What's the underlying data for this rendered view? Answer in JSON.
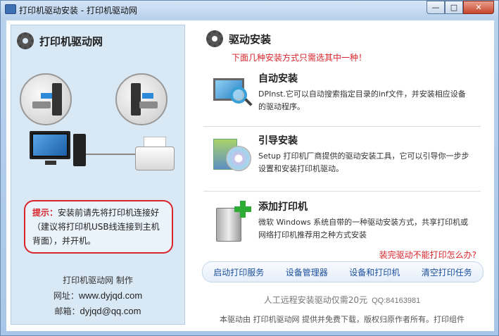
{
  "window": {
    "title": "打印机驱动安装 - 打印机驱动网",
    "controls": {
      "minimize": "—",
      "maximize": "□",
      "close": "✕"
    }
  },
  "left": {
    "header": "打印机驱动网",
    "tip_label": "提示：",
    "tip_text": "安装前请先将打印机连接好（建议将打印机USB线连接到主机背面），并开机。",
    "credit_line": "打印机驱动网  制作",
    "website_label": "网址：",
    "website": "www.dyjqd.com",
    "email_label": "邮箱：",
    "email": "dyjqd@qq.com"
  },
  "right": {
    "header": "驱动安装",
    "subtitle": "下面几种安装方式只需选其中一种！",
    "options": [
      {
        "title": "自动安装",
        "desc": "DPInst.它可以自动搜索指定目录的inf文件，并安装相应设备的驱动程序。",
        "icon": "monitor-magnifier-icon"
      },
      {
        "title": "引导安装",
        "desc": "Setup 打印机厂商提供的驱动安装工具，它可以引导你一步步设置和安装打印机驱动。",
        "icon": "setup-disc-icon"
      },
      {
        "title": "添加打印机",
        "desc": "微软 Windows 系统自带的一种驱动安装方式，共享打印机或网络打印机推荐用之种方式安装",
        "icon": "add-printer-icon"
      }
    ],
    "faq_link": "装完驱动不能打印怎么办?",
    "actions": [
      "启动打印服务",
      "设备管理器",
      "设备和打印机",
      "清空打印任务"
    ],
    "remote_text": "人工远程安装驱动仅需20元",
    "remote_qq": "QQ:84163981",
    "footer": "本驱动由 打印机驱动网 提供并免费下载，版权归原作者所有。打印组件"
  }
}
